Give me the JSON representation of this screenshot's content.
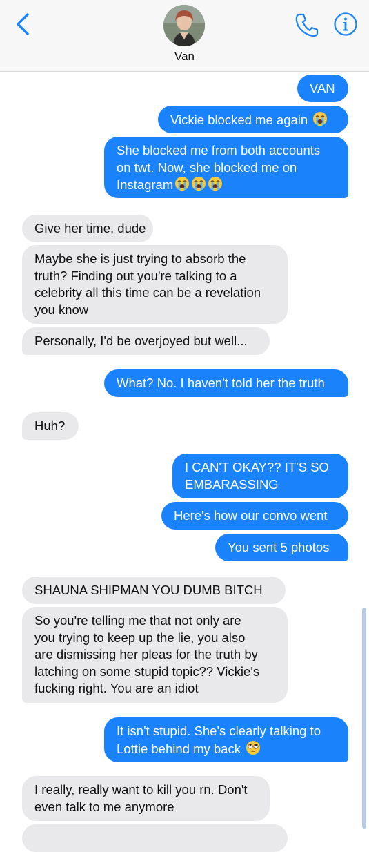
{
  "header": {
    "contact_name": "Van"
  },
  "icons": {
    "back": "chevron-left-icon",
    "phone": "phone-icon",
    "info": "info-icon"
  },
  "colors": {
    "outgoing": "#1a82fb",
    "incoming": "#e9e9eb",
    "accent": "#1a82fb"
  },
  "messages": [
    {
      "from": "me",
      "lines": [
        "VAN"
      ]
    },
    {
      "from": "me",
      "lines": [
        "Vickie blocked me again"
      ],
      "emoji": "loudly-crying-face"
    },
    {
      "from": "me",
      "lines": [
        "She blocked me from both accounts",
        "on twt. Now, she blocked me on",
        "Instagram"
      ],
      "emoji": "loudly-crying-face x3"
    },
    {
      "from": "them",
      "lines": [
        "Give her time, dude"
      ]
    },
    {
      "from": "them",
      "lines": [
        "Maybe she is just trying to absorb the",
        "truth? Finding out you're talking to a",
        "celebrity all this time can be a revelation",
        "you know"
      ]
    },
    {
      "from": "them",
      "lines": [
        "Personally, I'd be overjoyed but well..."
      ]
    },
    {
      "from": "me",
      "lines": [
        "What? No. I haven't told her the truth"
      ]
    },
    {
      "from": "them",
      "lines": [
        "Huh?"
      ]
    },
    {
      "from": "me",
      "lines": [
        "I CAN'T OKAY?? IT'S SO",
        "EMBARASSING"
      ]
    },
    {
      "from": "me",
      "lines": [
        "Here's how our convo went"
      ]
    },
    {
      "from": "me",
      "lines": [
        "You sent 5 photos"
      ]
    },
    {
      "from": "them",
      "lines": [
        "SHAUNA SHIPMAN YOU DUMB BITCH"
      ]
    },
    {
      "from": "them",
      "lines": [
        "So you're telling me that not only are",
        "you trying to keep up the lie, you also",
        "are dismissing her pleas for the truth by",
        "latching on some stupid topic?? Vickie's",
        "fucking right. You are an idiot"
      ]
    },
    {
      "from": "me",
      "lines": [
        "It isn't stupid. She's clearly talking to",
        "Lottie behind my back"
      ],
      "emoji": "face-with-rolling-eyes"
    },
    {
      "from": "them",
      "lines": [
        "I really, really want to kill you rn. Don't",
        "even talk to me anymore"
      ]
    }
  ]
}
